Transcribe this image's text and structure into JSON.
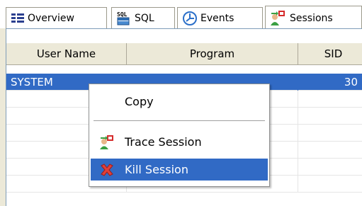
{
  "tabs": [
    {
      "label": "Overview",
      "icon": "overview-grid-icon"
    },
    {
      "label": "SQL",
      "icon": "sql-icon"
    },
    {
      "label": "Events",
      "icon": "events-clock-icon"
    },
    {
      "label": "Sessions",
      "icon": "sessions-icon"
    }
  ],
  "sql_icon_text": "SQL",
  "table": {
    "columns": [
      "User Name",
      "Program",
      "SID"
    ],
    "rows": [
      {
        "user": "SYSTEM",
        "program": "",
        "sid": "30"
      }
    ]
  },
  "context_menu": {
    "items": [
      {
        "label": "Copy",
        "icon": ""
      },
      {
        "label": "Trace Session",
        "icon": "trace-session-icon"
      },
      {
        "label": "Kill Session",
        "icon": "kill-session-icon"
      }
    ]
  },
  "colors": {
    "selection": "#316ac5",
    "header_bg": "#ece9d8"
  }
}
